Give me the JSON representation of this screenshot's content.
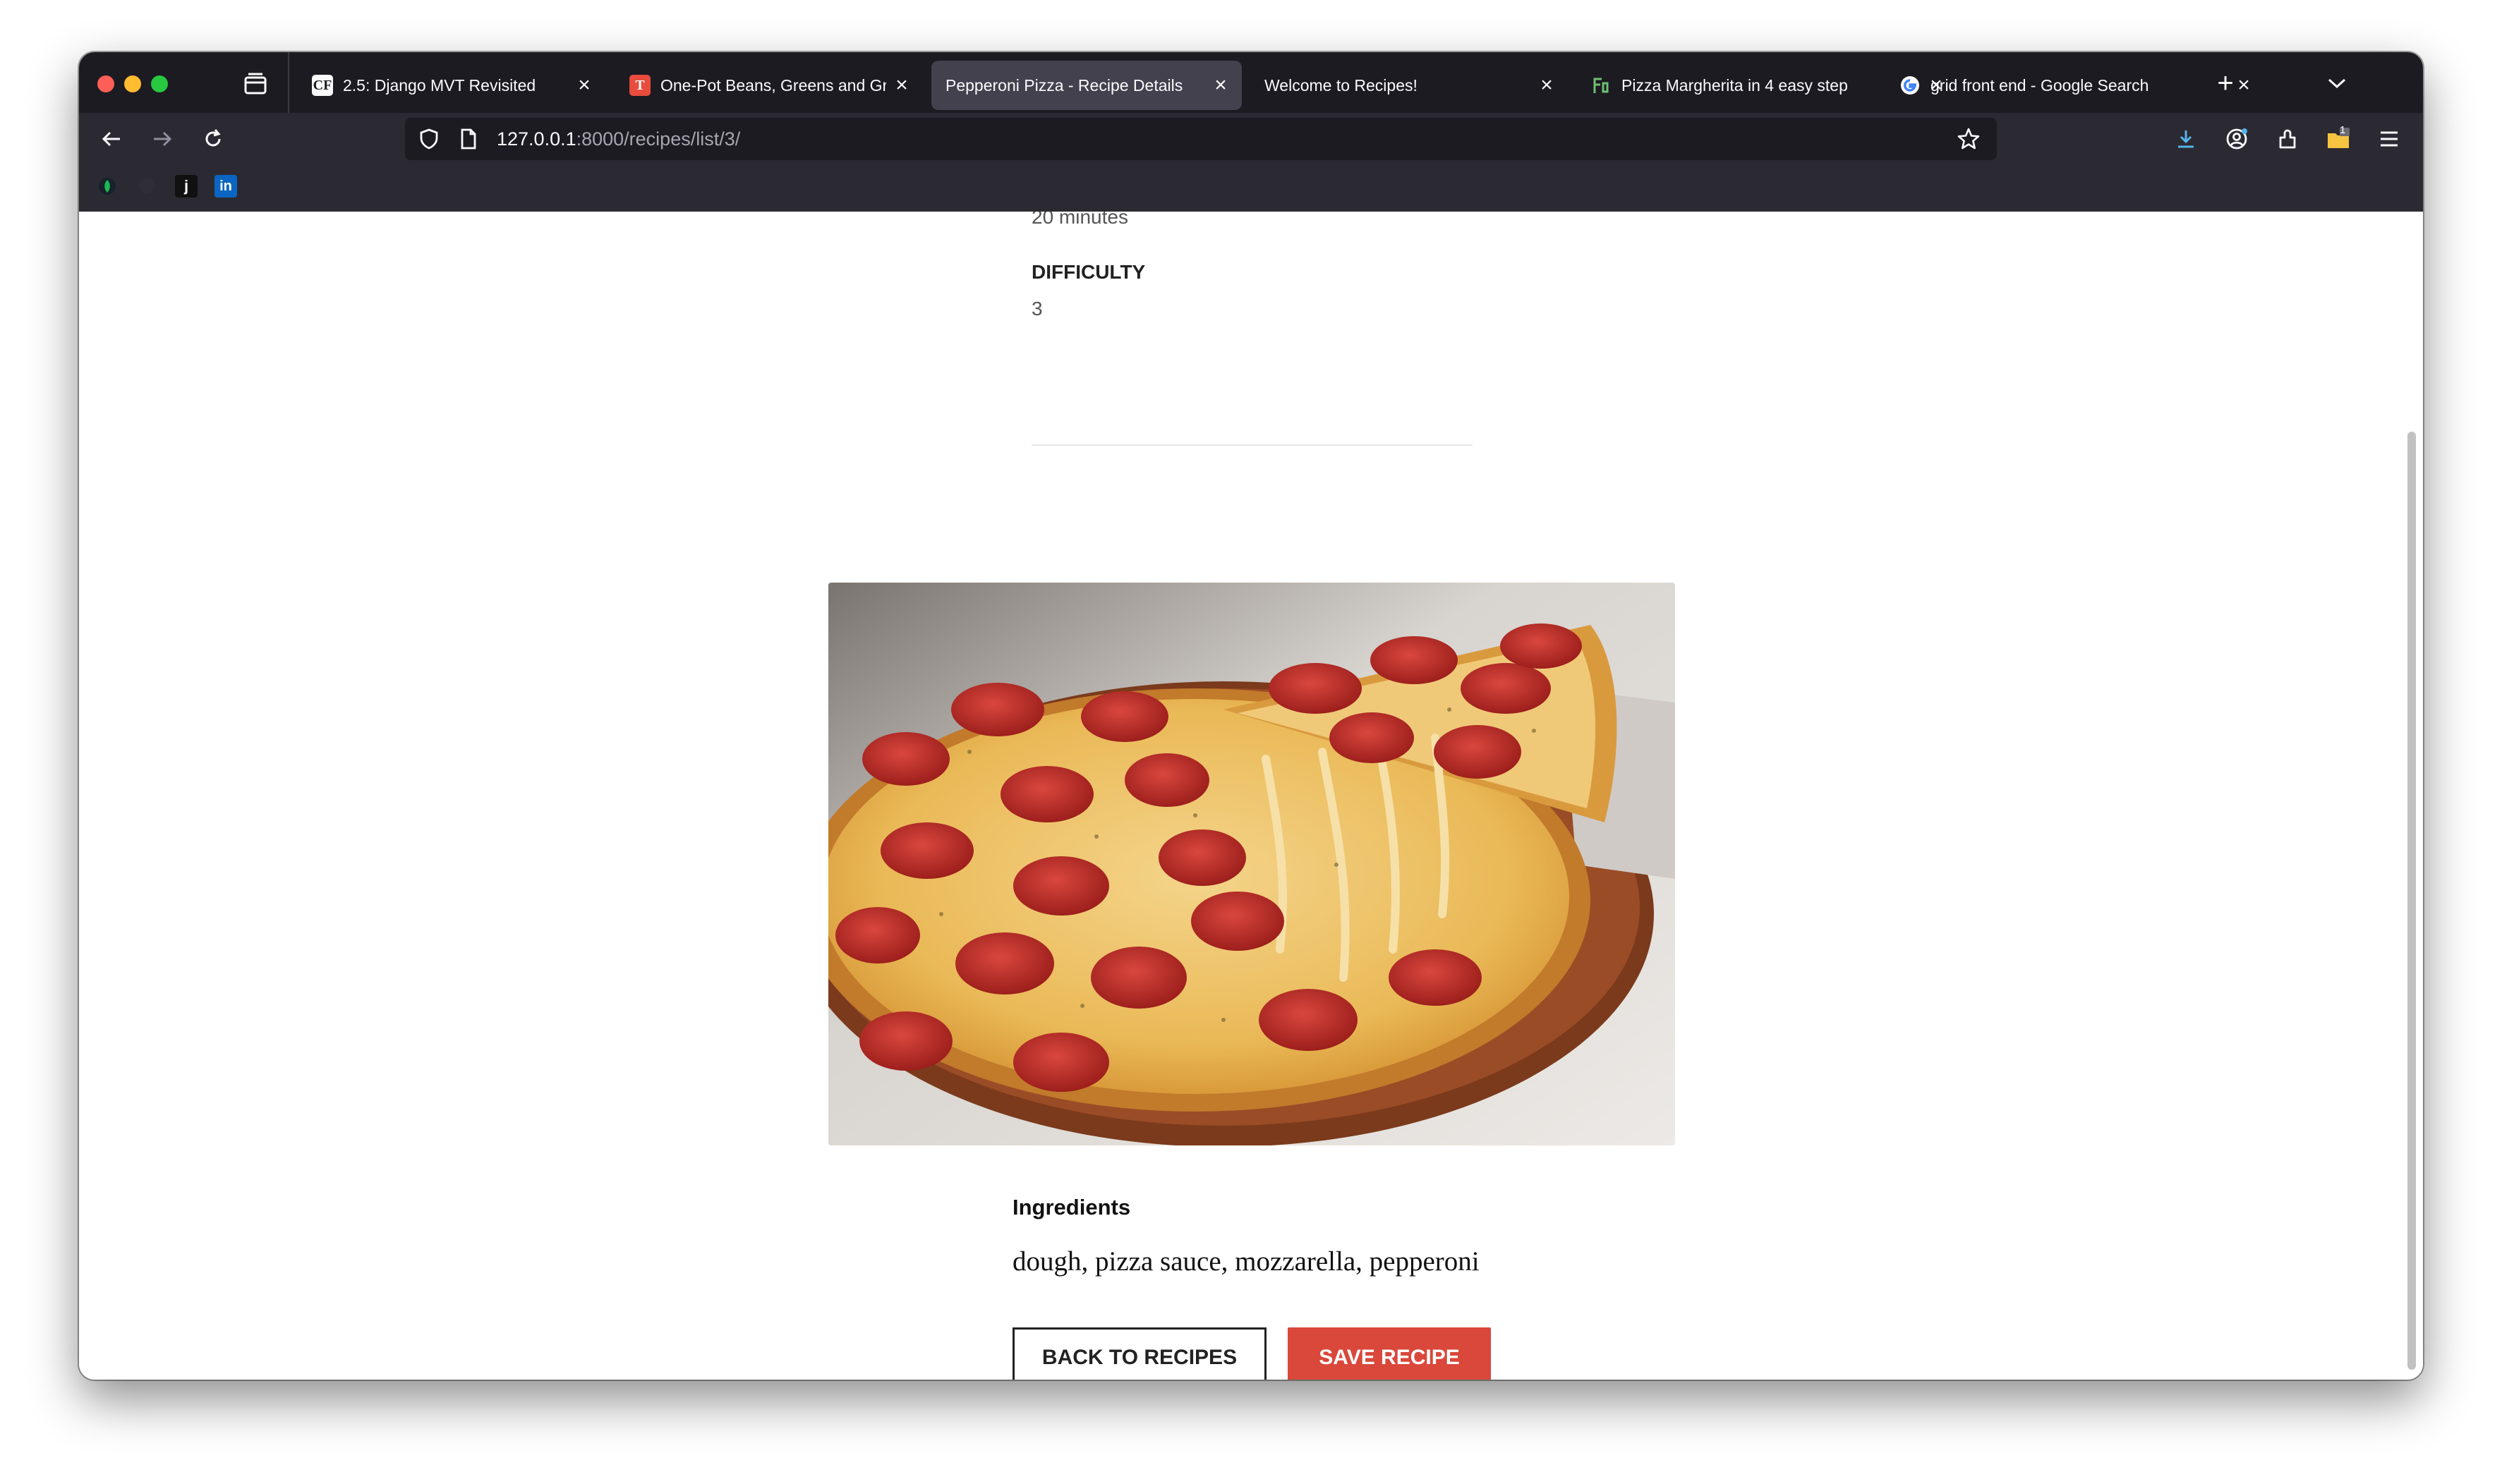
{
  "browser": {
    "tabs": [
      {
        "title": "2.5: Django MVT Revisited",
        "favicon": "cf-logo-icon",
        "active": false
      },
      {
        "title": "One-Pot Beans, Greens and Gra",
        "favicon": "nyt-icon",
        "active": false
      },
      {
        "title": "Pepperoni Pizza - Recipe Details",
        "favicon": "",
        "active": true
      },
      {
        "title": "Welcome to Recipes!",
        "favicon": "",
        "active": false
      },
      {
        "title": "Pizza Margherita in 4 easy step",
        "favicon": "cooking-site-icon",
        "active": false
      },
      {
        "title": "grid front end - Google Search",
        "favicon": "google-icon",
        "active": false
      }
    ],
    "url_host": "127.0.0.1",
    "url_path": ":8000/recipes/list/3/",
    "bookmarks": [
      "leaf-icon",
      "blank-bookmark",
      "j",
      "in"
    ],
    "extension_badge": "1"
  },
  "recipe": {
    "cooking_time_value": "20 minutes",
    "difficulty_label": "DIFFICULTY",
    "difficulty_value": "3",
    "image_alt": "Pepperoni pizza",
    "ingredients_heading": "Ingredients",
    "ingredients": "dough, pizza sauce, mozzarella, pepperoni"
  },
  "actions": {
    "back_label": "BACK TO RECIPES",
    "save_label": "SAVE RECIPE"
  },
  "colors": {
    "accent": "#d9483b",
    "chrome_dark": "#1c1b22",
    "chrome_mid": "#2b2a33",
    "active_tab": "#42414d"
  }
}
